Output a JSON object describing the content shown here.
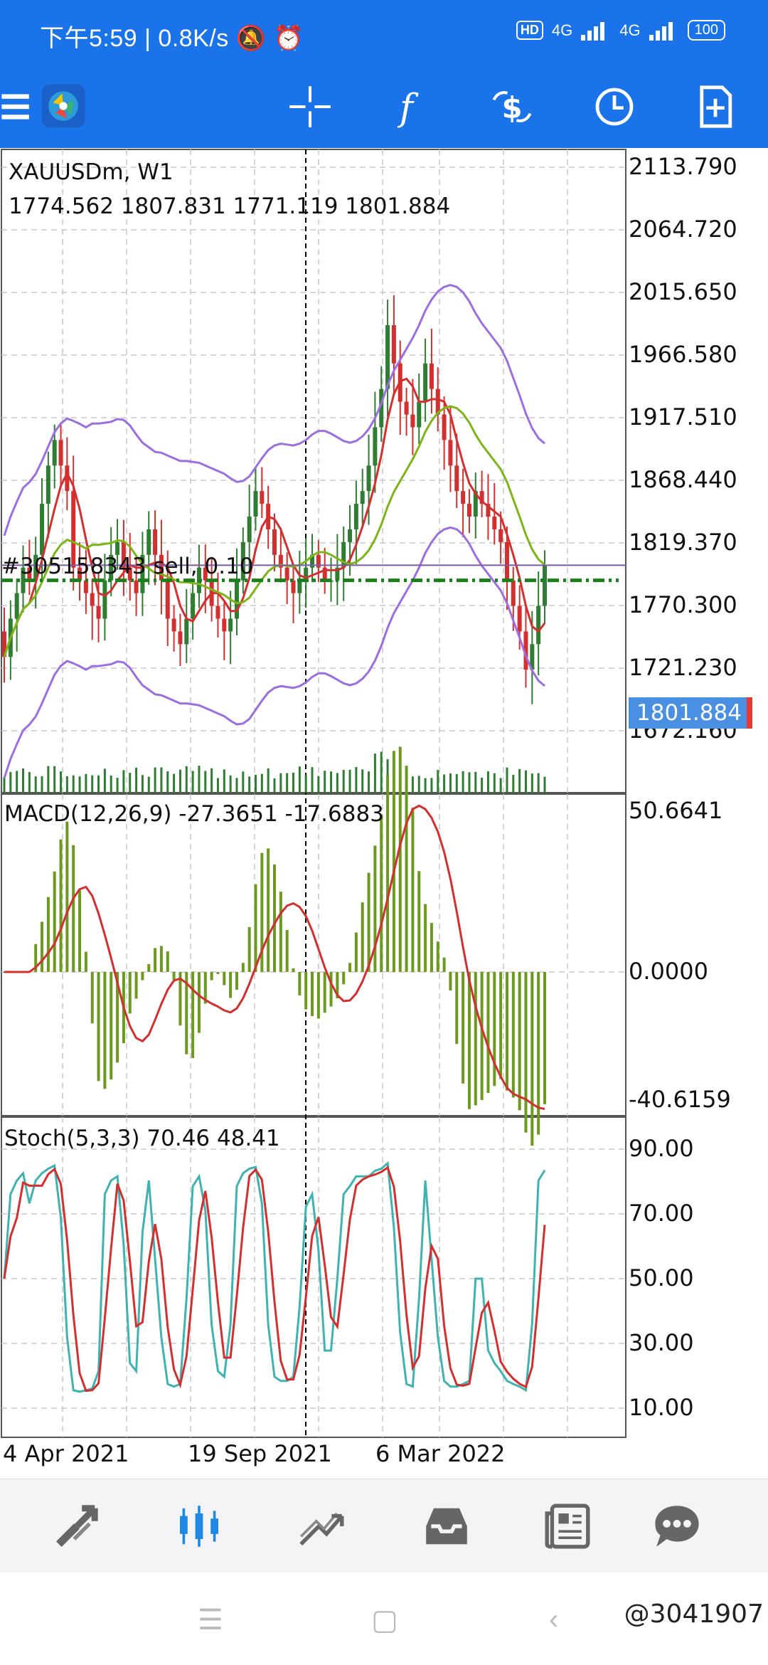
{
  "status_bar": {
    "time": "下午5:59",
    "net_speed": "0.8K/s",
    "hd": "HD",
    "net1": "4G",
    "net2": "4G",
    "battery": "100"
  },
  "toolbar": {
    "icons": [
      "menu-icon",
      "app-logo-icon",
      "crosshair-icon",
      "indicators-icon",
      "trade-icon",
      "timeframe-icon",
      "new-order-icon"
    ]
  },
  "chart": {
    "symbol_line": "XAUUSDm, W1",
    "ohlc_line": "1774.562 1807.831 1771.119 1801.884",
    "order_line": "#305158343 sell, 0.10",
    "bid": "1801.884",
    "price_axis": [
      "2113.790",
      "2064.720",
      "2015.650",
      "1966.580",
      "1917.510",
      "1868.440",
      "1819.370",
      "1770.300",
      "1721.230",
      "1672.160"
    ],
    "macd_title": "MACD(12,26,9) -27.3651 -17.6883",
    "macd_axis": [
      "50.6641",
      "0.0000",
      "-40.6159"
    ],
    "stoch_title": "Stoch(5,3,3) 70.46 48.41",
    "stoch_axis": [
      "90.00",
      "70.00",
      "50.00",
      "30.00",
      "10.00"
    ],
    "date_axis": [
      "4 Apr 2021",
      "19 Sep 2021",
      "6 Mar 2022"
    ],
    "colors": {
      "bull": "#2e7d32",
      "bear": "#d32f2f",
      "bands": "#9c6ee0",
      "ma_fast": "#d32f2f",
      "ma_slow": "#7cb518",
      "macd_hist": "#6b9a1e",
      "macd_signal": "#d32f2f",
      "stoch_main": "#3fb2b2",
      "stoch_signal": "#d32f2f",
      "order_line": "#1b7f1b"
    }
  },
  "bottom_nav": {
    "items": [
      "quotes-icon",
      "chart-icon",
      "trade-icon",
      "history-icon",
      "news-icon",
      "chat-icon"
    ]
  },
  "watermark": "@3041907"
}
